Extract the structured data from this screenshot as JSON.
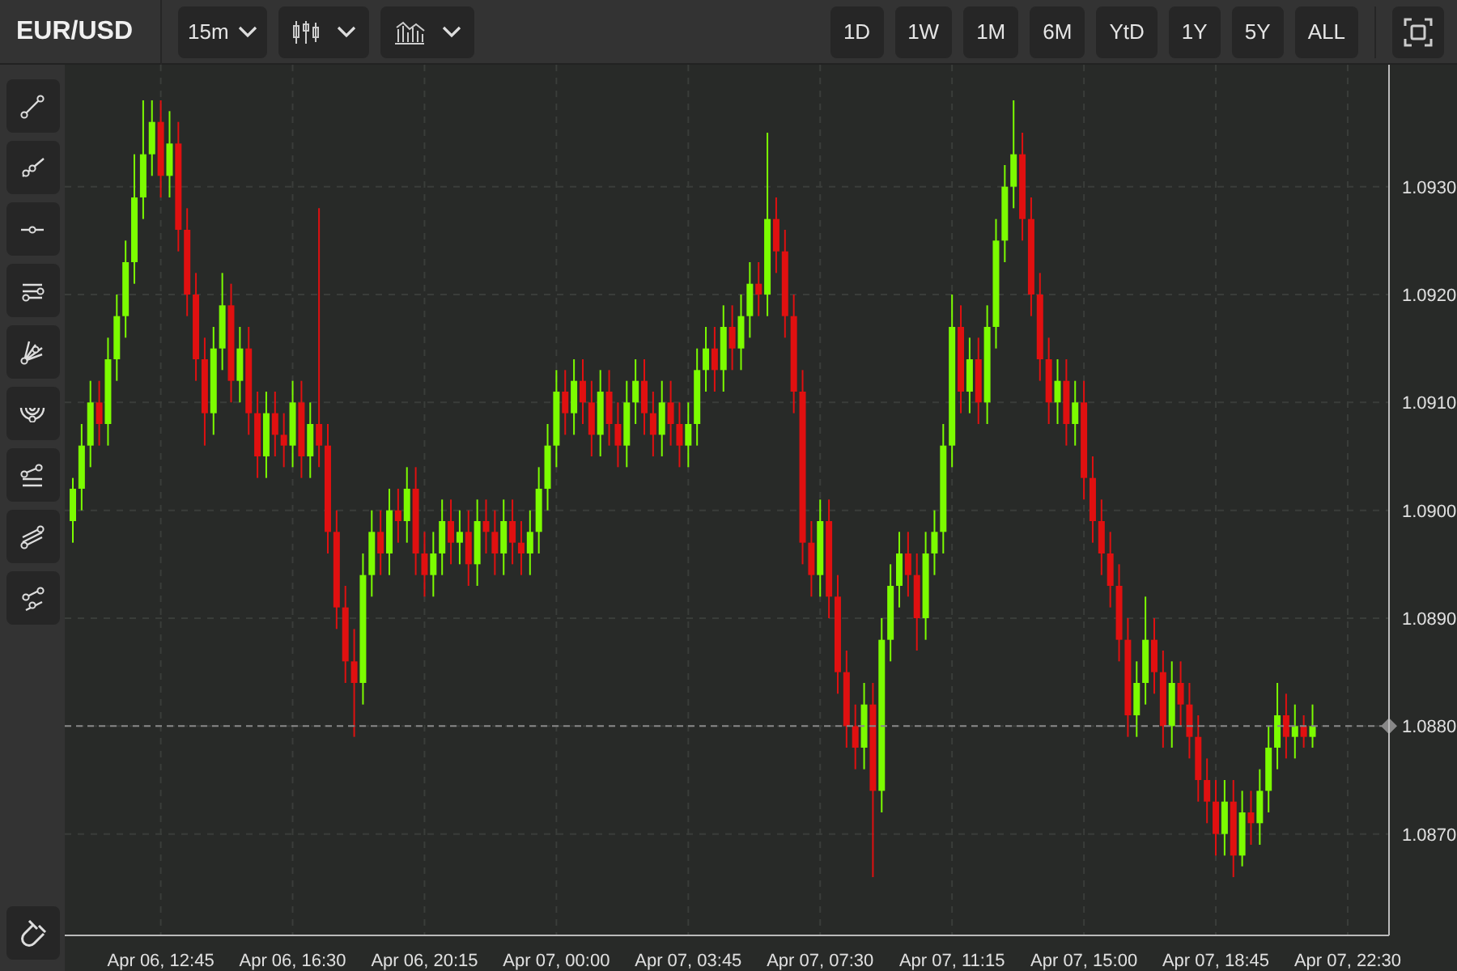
{
  "symbol": "EUR/USD",
  "interval": {
    "label": "15m"
  },
  "ranges": [
    {
      "label": "1D"
    },
    {
      "label": "1W"
    },
    {
      "label": "1M"
    },
    {
      "label": "6M"
    },
    {
      "label": "YtD"
    },
    {
      "label": "1Y"
    },
    {
      "label": "5Y"
    },
    {
      "label": "ALL"
    }
  ],
  "chart": {
    "chart_data": {
      "type": "candlestick",
      "categories": [
        null,
        null,
        null,
        null,
        null,
        null,
        null,
        null,
        null,
        null,
        "Apr 06, 12:45",
        null,
        null,
        null,
        null,
        null,
        null,
        null,
        null,
        null,
        null,
        null,
        null,
        null,
        null,
        "Apr 06, 16:30",
        null,
        null,
        null,
        null,
        null,
        null,
        null,
        null,
        null,
        null,
        null,
        null,
        null,
        null,
        "Apr 06, 20:15",
        null,
        null,
        null,
        null,
        null,
        null,
        null,
        null,
        null,
        null,
        null,
        null,
        null,
        null,
        "Apr 07, 00:00",
        null,
        null,
        null,
        null,
        null,
        null,
        null,
        null,
        null,
        null,
        null,
        null,
        null,
        null,
        "Apr 07, 03:45",
        null,
        null,
        null,
        null,
        null,
        null,
        null,
        null,
        null,
        null,
        null,
        null,
        null,
        null,
        "Apr 07, 07:30",
        null,
        null,
        null,
        null,
        null,
        null,
        null,
        null,
        null,
        null,
        null,
        null,
        null,
        null,
        "Apr 07, 11:15",
        null,
        null,
        null,
        null,
        null,
        null,
        null,
        null,
        null,
        null,
        null,
        null,
        null,
        null,
        "Apr 07, 15:00",
        null,
        null,
        null,
        null,
        null,
        null,
        null,
        null,
        null,
        null,
        null,
        null,
        null,
        null,
        "Apr 07, 18:45",
        null,
        null,
        null,
        null,
        null,
        null,
        null,
        null,
        null,
        null,
        null,
        null,
        null,
        null,
        "Apr 07, 22:30"
      ],
      "ohlc": [
        [
          1.0899,
          1.0903,
          1.0897,
          1.0902
        ],
        [
          1.0902,
          1.0908,
          1.09,
          1.0906
        ],
        [
          1.0906,
          1.0912,
          1.0904,
          1.091
        ],
        [
          1.091,
          1.0912,
          1.0906,
          1.0908
        ],
        [
          1.0908,
          1.0916,
          1.0906,
          1.0914
        ],
        [
          1.0914,
          1.092,
          1.0912,
          1.0918
        ],
        [
          1.0918,
          1.0925,
          1.0916,
          1.0923
        ],
        [
          1.0923,
          1.0933,
          1.0921,
          1.0929
        ],
        [
          1.0929,
          1.0938,
          1.0927,
          1.0933
        ],
        [
          1.0933,
          1.0938,
          1.0931,
          1.0936
        ],
        [
          1.0936,
          1.0938,
          1.0929,
          1.0931
        ],
        [
          1.0931,
          1.0937,
          1.0929,
          1.0934
        ],
        [
          1.0934,
          1.0936,
          1.0924,
          1.0926
        ],
        [
          1.0926,
          1.0928,
          1.0918,
          1.092
        ],
        [
          1.092,
          1.0922,
          1.0912,
          1.0914
        ],
        [
          1.0914,
          1.0916,
          1.0906,
          1.0909
        ],
        [
          1.0909,
          1.0917,
          1.0907,
          1.0915
        ],
        [
          1.0915,
          1.0922,
          1.0913,
          1.0919
        ],
        [
          1.0919,
          1.0921,
          1.091,
          1.0912
        ],
        [
          1.0912,
          1.0917,
          1.091,
          1.0915
        ],
        [
          1.0915,
          1.0917,
          1.0907,
          1.0909
        ],
        [
          1.0909,
          1.0911,
          1.0903,
          1.0905
        ],
        [
          1.0905,
          1.0911,
          1.0903,
          1.0909
        ],
        [
          1.0909,
          1.0911,
          1.0905,
          1.0907
        ],
        [
          1.0907,
          1.0909,
          1.0904,
          1.0906
        ],
        [
          1.0906,
          1.0912,
          1.0904,
          1.091
        ],
        [
          1.091,
          1.0912,
          1.0903,
          1.0905
        ],
        [
          1.0905,
          1.091,
          1.0903,
          1.0908
        ],
        [
          1.0908,
          1.0928,
          1.0904,
          1.0906
        ],
        [
          1.0906,
          1.0908,
          1.0896,
          1.0898
        ],
        [
          1.0898,
          1.09,
          1.0889,
          1.0891
        ],
        [
          1.0891,
          1.0893,
          1.0884,
          1.0886
        ],
        [
          1.0886,
          1.0889,
          1.0879,
          1.0884
        ],
        [
          1.0884,
          1.0896,
          1.0882,
          1.0894
        ],
        [
          1.0894,
          1.09,
          1.0892,
          1.0898
        ],
        [
          1.0898,
          1.09,
          1.0894,
          1.0896
        ],
        [
          1.0896,
          1.0902,
          1.0894,
          1.09
        ],
        [
          1.09,
          1.0902,
          1.0897,
          1.0899
        ],
        [
          1.0899,
          1.0904,
          1.0897,
          1.0902
        ],
        [
          1.0902,
          1.0904,
          1.0894,
          1.0896
        ],
        [
          1.0896,
          1.0898,
          1.0892,
          1.0894
        ],
        [
          1.0894,
          1.0898,
          1.0892,
          1.0896
        ],
        [
          1.0896,
          1.0901,
          1.0894,
          1.0899
        ],
        [
          1.0899,
          1.0901,
          1.0895,
          1.0897
        ],
        [
          1.0897,
          1.09,
          1.0895,
          1.0898
        ],
        [
          1.0898,
          1.09,
          1.0893,
          1.0895
        ],
        [
          1.0895,
          1.0901,
          1.0893,
          1.0899
        ],
        [
          1.0899,
          1.0901,
          1.0896,
          1.0898
        ],
        [
          1.0898,
          1.09,
          1.0894,
          1.0896
        ],
        [
          1.0896,
          1.0901,
          1.0894,
          1.0899
        ],
        [
          1.0899,
          1.0901,
          1.0895,
          1.0897
        ],
        [
          1.0897,
          1.0899,
          1.0894,
          1.0896
        ],
        [
          1.0896,
          1.09,
          1.0894,
          1.0898
        ],
        [
          1.0898,
          1.0904,
          1.0896,
          1.0902
        ],
        [
          1.0902,
          1.0908,
          1.09,
          1.0906
        ],
        [
          1.0906,
          1.0913,
          1.0904,
          1.0911
        ],
        [
          1.0911,
          1.0913,
          1.0907,
          1.0909
        ],
        [
          1.0909,
          1.0914,
          1.0907,
          1.0912
        ],
        [
          1.0912,
          1.0914,
          1.0908,
          1.091
        ],
        [
          1.091,
          1.0912,
          1.0905,
          1.0907
        ],
        [
          1.0907,
          1.0913,
          1.0905,
          1.0911
        ],
        [
          1.0911,
          1.0913,
          1.0906,
          1.0908
        ],
        [
          1.0908,
          1.091,
          1.0904,
          1.0906
        ],
        [
          1.0906,
          1.0912,
          1.0904,
          1.091
        ],
        [
          1.091,
          1.0914,
          1.0908,
          1.0912
        ],
        [
          1.0912,
          1.0914,
          1.0907,
          1.0909
        ],
        [
          1.0909,
          1.0911,
          1.0905,
          1.0907
        ],
        [
          1.0907,
          1.0912,
          1.0905,
          1.091
        ],
        [
          1.091,
          1.0912,
          1.0906,
          1.0908
        ],
        [
          1.0908,
          1.091,
          1.0904,
          1.0906
        ],
        [
          1.0906,
          1.091,
          1.0904,
          1.0908
        ],
        [
          1.0908,
          1.0915,
          1.0906,
          1.0913
        ],
        [
          1.0913,
          1.0917,
          1.0911,
          1.0915
        ],
        [
          1.0915,
          1.0917,
          1.0911,
          1.0913
        ],
        [
          1.0913,
          1.0919,
          1.0911,
          1.0917
        ],
        [
          1.0917,
          1.0919,
          1.0913,
          1.0915
        ],
        [
          1.0915,
          1.092,
          1.0913,
          1.0918
        ],
        [
          1.0918,
          1.0923,
          1.0916,
          1.0921
        ],
        [
          1.0921,
          1.0923,
          1.0918,
          1.092
        ],
        [
          1.092,
          1.0935,
          1.0918,
          1.0927
        ],
        [
          1.0927,
          1.0929,
          1.0922,
          1.0924
        ],
        [
          1.0924,
          1.0926,
          1.0916,
          1.0918
        ],
        [
          1.0918,
          1.092,
          1.0909,
          1.0911
        ],
        [
          1.0911,
          1.0913,
          1.0895,
          1.0897
        ],
        [
          1.0897,
          1.0899,
          1.0892,
          1.0894
        ],
        [
          1.0894,
          1.0901,
          1.0892,
          1.0899
        ],
        [
          1.0899,
          1.0901,
          1.089,
          1.0892
        ],
        [
          1.0892,
          1.0894,
          1.0883,
          1.0885
        ],
        [
          1.0885,
          1.0887,
          1.0878,
          1.088
        ],
        [
          1.088,
          1.0882,
          1.0876,
          1.0878
        ],
        [
          1.0878,
          1.0884,
          1.0876,
          1.0882
        ],
        [
          1.0882,
          1.0884,
          1.0866,
          1.0874
        ],
        [
          1.0874,
          1.089,
          1.0872,
          1.0888
        ],
        [
          1.0888,
          1.0895,
          1.0886,
          1.0893
        ],
        [
          1.0893,
          1.0898,
          1.0891,
          1.0896
        ],
        [
          1.0896,
          1.0898,
          1.0892,
          1.0894
        ],
        [
          1.0894,
          1.0896,
          1.0887,
          1.089
        ],
        [
          1.089,
          1.0898,
          1.0888,
          1.0896
        ],
        [
          1.0896,
          1.09,
          1.0894,
          1.0898
        ],
        [
          1.0898,
          1.0908,
          1.0896,
          1.0906
        ],
        [
          1.0906,
          1.092,
          1.0904,
          1.0917
        ],
        [
          1.0917,
          1.0919,
          1.0909,
          1.0911
        ],
        [
          1.0911,
          1.0916,
          1.0909,
          1.0914
        ],
        [
          1.0914,
          1.0916,
          1.0908,
          1.091
        ],
        [
          1.091,
          1.0919,
          1.0908,
          1.0917
        ],
        [
          1.0917,
          1.0927,
          1.0915,
          1.0925
        ],
        [
          1.0925,
          1.0932,
          1.0923,
          1.093
        ],
        [
          1.093,
          1.0938,
          1.0928,
          1.0933
        ],
        [
          1.0933,
          1.0935,
          1.0925,
          1.0927
        ],
        [
          1.0927,
          1.0929,
          1.0918,
          1.092
        ],
        [
          1.092,
          1.0922,
          1.0912,
          1.0914
        ],
        [
          1.0914,
          1.0916,
          1.0908,
          1.091
        ],
        [
          1.091,
          1.0914,
          1.0908,
          1.0912
        ],
        [
          1.0912,
          1.0914,
          1.0906,
          1.0908
        ],
        [
          1.0908,
          1.0912,
          1.0906,
          1.091
        ],
        [
          1.091,
          1.0912,
          1.0901,
          1.0903
        ],
        [
          1.0903,
          1.0905,
          1.0897,
          1.0899
        ],
        [
          1.0899,
          1.0901,
          1.0894,
          1.0896
        ],
        [
          1.0896,
          1.0898,
          1.0891,
          1.0893
        ],
        [
          1.0893,
          1.0895,
          1.0886,
          1.0888
        ],
        [
          1.0888,
          1.089,
          1.0879,
          1.0881
        ],
        [
          1.0881,
          1.0886,
          1.0879,
          1.0884
        ],
        [
          1.0884,
          1.0892,
          1.0882,
          1.0888
        ],
        [
          1.0888,
          1.089,
          1.0883,
          1.0885
        ],
        [
          1.0885,
          1.0887,
          1.0878,
          1.088
        ],
        [
          1.088,
          1.0886,
          1.0878,
          1.0884
        ],
        [
          1.0884,
          1.0886,
          1.088,
          1.0882
        ],
        [
          1.0882,
          1.0884,
          1.0877,
          1.0879
        ],
        [
          1.0879,
          1.0881,
          1.0873,
          1.0875
        ],
        [
          1.0875,
          1.0877,
          1.0871,
          1.0873
        ],
        [
          1.0873,
          1.0875,
          1.0868,
          1.087
        ],
        [
          1.087,
          1.0875,
          1.0868,
          1.0873
        ],
        [
          1.0873,
          1.0875,
          1.0866,
          1.0868
        ],
        [
          1.0868,
          1.0874,
          1.0867,
          1.0872
        ],
        [
          1.0872,
          1.0874,
          1.0869,
          1.0871
        ],
        [
          1.0871,
          1.0876,
          1.0869,
          1.0874
        ],
        [
          1.0874,
          1.088,
          1.0872,
          1.0878
        ],
        [
          1.0878,
          1.0884,
          1.0876,
          1.0881
        ],
        [
          1.0881,
          1.0883,
          1.0877,
          1.0879
        ],
        [
          1.0879,
          1.0882,
          1.0877,
          1.088
        ],
        [
          1.088,
          1.0881,
          1.0878,
          1.0879
        ],
        [
          1.0879,
          1.0882,
          1.0878,
          1.088
        ],
        null,
        null,
        null,
        null
      ],
      "ylim": [
        1.08606,
        1.09413
      ],
      "grid": true,
      "ref_lines": [
        {
          "axis": "y",
          "value": 1.088
        }
      ],
      "yticks": [
        {
          "value": 1.093,
          "label": "1.0930"
        },
        {
          "value": 1.092,
          "label": "1.0920"
        },
        {
          "value": 1.091,
          "label": "1.0910"
        },
        {
          "value": 1.09,
          "label": "1.0900"
        },
        {
          "value": 1.089,
          "label": "1.0890"
        },
        {
          "value": 1.088,
          "label": "1.0880"
        },
        {
          "value": 1.087,
          "label": "1.0870"
        }
      ]
    }
  }
}
